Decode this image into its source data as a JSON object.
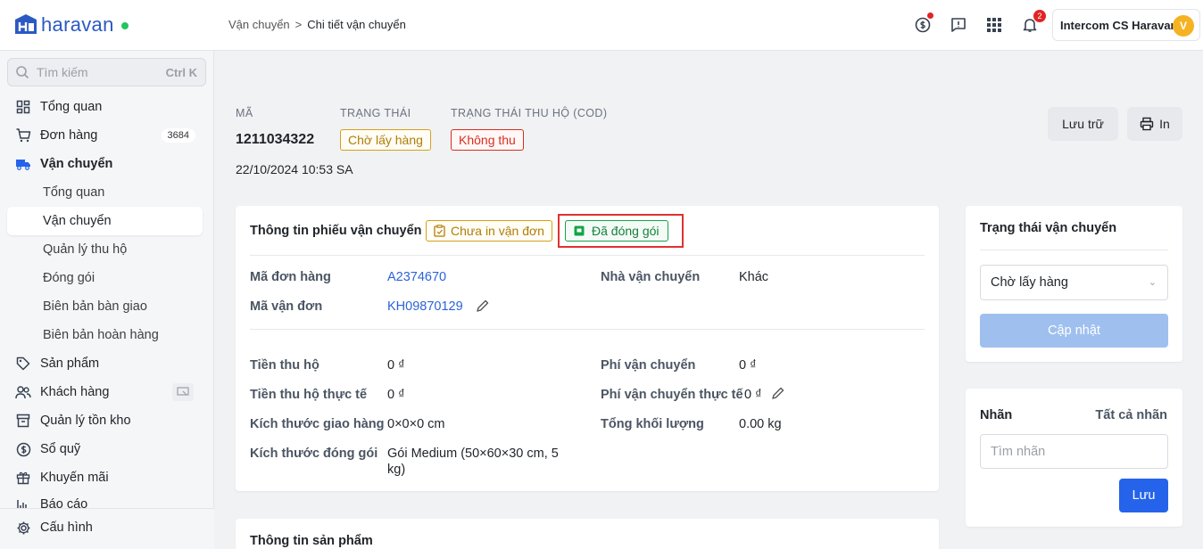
{
  "app": {
    "logo_text": "haravan"
  },
  "breadcrumb": {
    "parent": "Vận chuyển",
    "separator": ">",
    "current": "Chi tiết vận chuyển"
  },
  "topbar": {
    "notification_count": "2",
    "account_name": "Intercom CS Haravan",
    "avatar_initial": "V"
  },
  "sidebar": {
    "search_placeholder": "Tìm kiếm",
    "search_shortcut": "Ctrl K",
    "items": [
      {
        "label": "Tổng quan"
      },
      {
        "label": "Đơn hàng",
        "count": "3684"
      },
      {
        "label": "Vận chuyển"
      },
      {
        "label": "Tổng quan"
      },
      {
        "label": "Vận chuyển"
      },
      {
        "label": "Quản lý thu hộ"
      },
      {
        "label": "Đóng gói"
      },
      {
        "label": "Biên bản bàn giao"
      },
      {
        "label": "Biên bản hoàn hàng"
      },
      {
        "label": "Sản phẩm"
      },
      {
        "label": "Khách hàng"
      },
      {
        "label": "Quản lý tồn kho"
      },
      {
        "label": "Sổ quỹ"
      },
      {
        "label": "Khuyến mãi"
      },
      {
        "label": "Báo cáo"
      }
    ],
    "settings_label": "Cấu hình"
  },
  "header": {
    "code_label": "MÃ",
    "code": "1211034322",
    "status_label": "TRẠNG THÁI",
    "status": "Chờ lấy hàng",
    "cod_label": "TRẠNG THÁI THU HỘ (COD)",
    "cod_status": "Không thu",
    "datetime": "22/10/2024 10:53 SA",
    "archive_button": "Lưu trữ",
    "print_button": "In"
  },
  "shipment_card": {
    "title": "Thông tin phiếu vận chuyển",
    "tag_unprinted": "Chưa in vận đơn",
    "tag_packed": "Đã đóng gói",
    "order_code_label": "Mã đơn hàng",
    "order_code": "A2374670",
    "waybill_label": "Mã vận đơn",
    "waybill": "KH09870129",
    "carrier_label": "Nhà vận chuyển",
    "carrier": "Khác",
    "cod_label": "Tiền thu hộ",
    "cod": "0 ₫",
    "cod_actual_label": "Tiền thu hộ thực tế",
    "cod_actual": "0 ₫",
    "ship_size_label": "Kích thước giao hàng",
    "ship_size": "0×0×0 cm",
    "pack_size_label": "Kích thước đóng gói",
    "pack_size_line1": "Gói Medium (50×60×30 cm, 5",
    "pack_size_line2": "kg)",
    "fee_label": "Phí vận chuyển",
    "fee": "0 ₫",
    "fee_actual_label": "Phí vận chuyển thực tế",
    "fee_actual": "0 ₫",
    "weight_label": "Tổng khối lượng",
    "weight": "0.00 kg"
  },
  "product_card": {
    "title": "Thông tin sản phẩm"
  },
  "status_card": {
    "title": "Trạng thái vận chuyển",
    "selected": "Chờ lấy hàng",
    "update_button": "Cập nhật"
  },
  "tags_card": {
    "title": "Nhãn",
    "all_tags_link": "Tất cả nhãn",
    "input_placeholder": "Tìm nhãn",
    "save_button": "Lưu"
  },
  "colors": {
    "brand": "#2b59c3",
    "primary": "#2563eb",
    "highlight": "#e03131"
  }
}
